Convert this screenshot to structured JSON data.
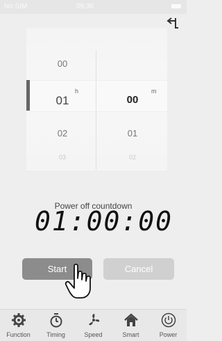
{
  "status_bar": {
    "carrier": "No SIM",
    "time": "09:36"
  },
  "picker": {
    "hours": {
      "above_2": "",
      "above": "00",
      "selected": "01",
      "below": "02",
      "below_2": "03",
      "unit": "h"
    },
    "minutes": {
      "above": "",
      "selected": "00",
      "below": "01",
      "below_2": "02",
      "unit": "m"
    }
  },
  "countdown": {
    "caption": "Power off countdown",
    "display": "01:00:00"
  },
  "buttons": {
    "start": "Start",
    "cancel": "Cancel"
  },
  "tabs": [
    {
      "label": "Function",
      "icon": "gear-icon"
    },
    {
      "label": "Timing",
      "icon": "stopwatch-icon"
    },
    {
      "label": "Speed",
      "icon": "fan-icon"
    },
    {
      "label": "Smart",
      "icon": "home-icon"
    },
    {
      "label": "Power",
      "icon": "power-icon"
    }
  ],
  "colors": {
    "start_button": "#8c8c8c",
    "cancel_button": "#d0d0d0",
    "background": "#eeeeee"
  }
}
